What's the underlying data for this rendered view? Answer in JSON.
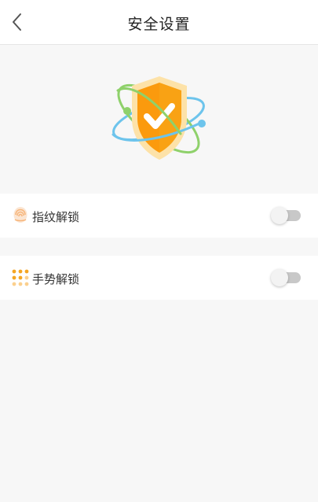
{
  "header": {
    "title": "安全设置",
    "back_icon": "chevron-left-icon"
  },
  "hero": {
    "icon": "shield-check-icon"
  },
  "settings": [
    {
      "label": "指纹解锁",
      "icon": "fingerprint-icon",
      "enabled": false
    },
    {
      "label": "手势解锁",
      "icon": "gesture-dots-icon",
      "enabled": false
    }
  ],
  "colors": {
    "accent": "#f5a623",
    "shield": "#fb9a0d",
    "orbit_green": "#8fd16b",
    "orbit_blue": "#6dc4ec",
    "toggle_off": "#c8c8c8"
  }
}
